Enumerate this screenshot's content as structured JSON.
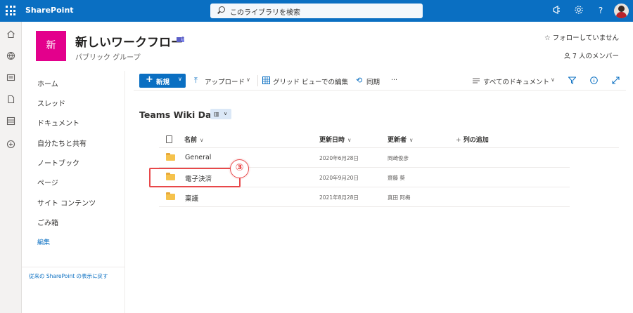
{
  "suitebar": {
    "brand": "SharePoint",
    "search_placeholder": "このライブラリを検索"
  },
  "site": {
    "logo_letter": "新",
    "title": "新しいワークフロー",
    "subtitle": "パブリック グループ",
    "follow_label": "フォローしていません",
    "members_label": "7 人のメンバー"
  },
  "leftnav": {
    "items": [
      {
        "label": "ホーム"
      },
      {
        "label": "スレッド"
      },
      {
        "label": "ドキュメント"
      },
      {
        "label": "自分たちと共有"
      },
      {
        "label": "ノートブック"
      },
      {
        "label": "ページ"
      },
      {
        "label": "サイト コンテンツ"
      },
      {
        "label": "ごみ箱"
      }
    ],
    "edit_label": "編集",
    "classic_link": "従来の SharePoint の表示に戻す"
  },
  "commandbar": {
    "new_label": "新規",
    "upload_label": "アップロード",
    "grid_label": "グリッド ビューでの編集",
    "sync_label": "同期",
    "more_label": "···",
    "view_label": "すべてのドキュメント"
  },
  "library": {
    "title": "Teams Wiki Data",
    "columns": {
      "name": "名前",
      "modified": "更新日時",
      "modified_by": "更新者",
      "add_column": "列の追加"
    },
    "rows": [
      {
        "name": "General",
        "modified": "2020年6月28日",
        "modified_by": "岡崎俊彦"
      },
      {
        "name": "電子決済",
        "modified": "2020年9月20日",
        "modified_by": "齋藤 葵"
      },
      {
        "name": "稟議",
        "modified": "2021年8月28日",
        "modified_by": "真田 阿梅"
      }
    ]
  },
  "annotation": {
    "callout_number": "③"
  },
  "colors": {
    "suitebar": "#0a6fc2",
    "site_logo": "#e3008c",
    "highlight": "#e8484a"
  }
}
